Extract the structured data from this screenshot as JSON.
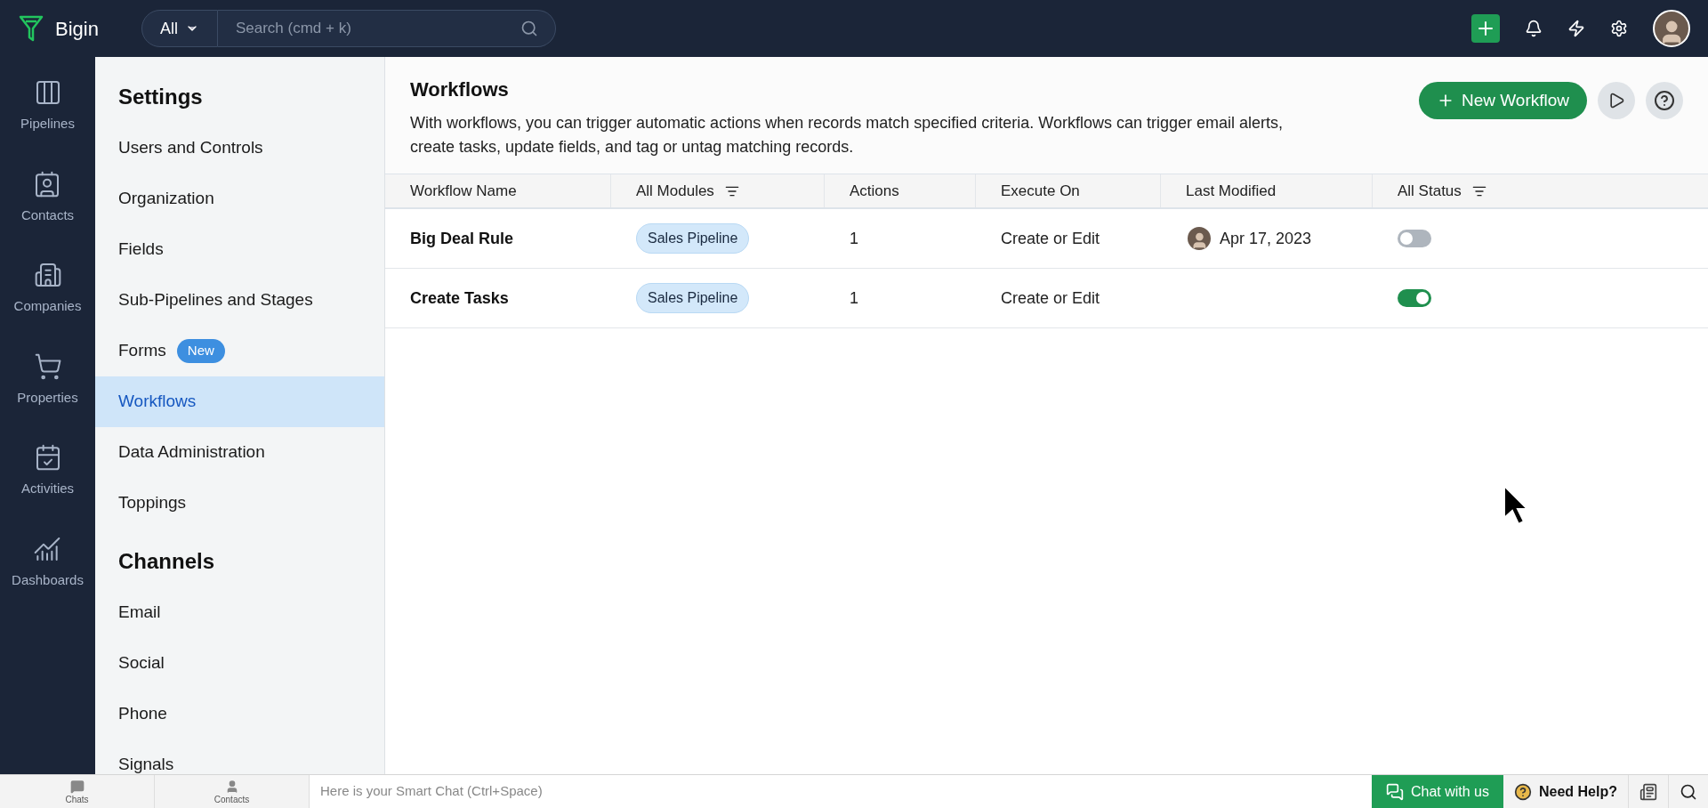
{
  "topbar": {
    "brand": "Bigin",
    "search_scope": "All",
    "search_placeholder": "Search (cmd + k)"
  },
  "rail": [
    {
      "label": "Pipelines",
      "kind": "pipelines"
    },
    {
      "label": "Contacts",
      "kind": "contacts"
    },
    {
      "label": "Companies",
      "kind": "companies"
    },
    {
      "label": "Properties",
      "kind": "properties"
    },
    {
      "label": "Activities",
      "kind": "activities"
    },
    {
      "label": "Dashboards",
      "kind": "dashboards"
    }
  ],
  "sidebar": {
    "sections": [
      {
        "title": "Settings",
        "items": [
          {
            "label": "Users and Controls",
            "selected": false
          },
          {
            "label": "Organization",
            "selected": false
          },
          {
            "label": "Fields",
            "selected": false
          },
          {
            "label": "Sub-Pipelines and Stages",
            "selected": false
          },
          {
            "label": "Forms",
            "badge": "New",
            "selected": false
          },
          {
            "label": "Workflows",
            "selected": true
          },
          {
            "label": "Data Administration",
            "selected": false
          },
          {
            "label": "Toppings",
            "selected": false
          }
        ]
      },
      {
        "title": "Channels",
        "items": [
          {
            "label": "Email",
            "selected": false
          },
          {
            "label": "Social",
            "selected": false
          },
          {
            "label": "Phone",
            "selected": false
          },
          {
            "label": "Signals",
            "selected": false
          }
        ]
      }
    ]
  },
  "page": {
    "title": "Workflows",
    "description": "With workflows, you can trigger automatic actions when records match specified criteria. Workflows can trigger email alerts, create tasks, update fields, and tag or untag matching records.",
    "new_button": "New Workflow"
  },
  "table": {
    "columns": [
      {
        "label": "Workflow Name",
        "filter": false
      },
      {
        "label": "All Modules",
        "filter": true
      },
      {
        "label": "Actions",
        "filter": false
      },
      {
        "label": "Execute On",
        "filter": false
      },
      {
        "label": "Last Modified",
        "filter": false
      },
      {
        "label": "All Status",
        "filter": true
      }
    ],
    "rows": [
      {
        "name": "Big Deal Rule",
        "module": "Sales Pipeline",
        "actions": "1",
        "execute_on": "Create or Edit",
        "last_modified": "Apr 17, 2023",
        "on": false
      },
      {
        "name": "Create Tasks",
        "module": "Sales Pipeline",
        "actions": "1",
        "execute_on": "Create or Edit",
        "on": true
      }
    ]
  },
  "bottombar": {
    "tabs": [
      "Chats",
      "Contacts"
    ],
    "chat_placeholder": "Here is your Smart Chat (Ctrl+Space)",
    "chat_button": "Chat with us",
    "help_button": "Need Help?"
  }
}
